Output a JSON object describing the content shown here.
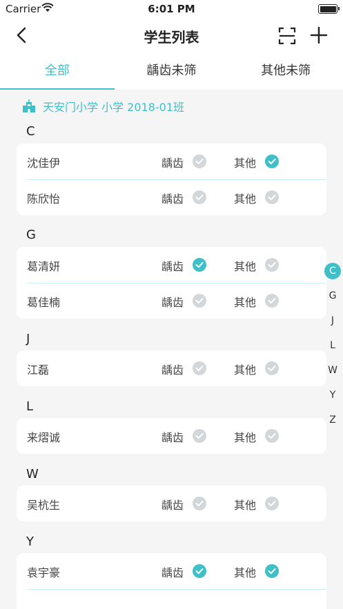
{
  "status_bar": {
    "carrier": "Carrier",
    "time": "6:01 PM"
  },
  "nav": {
    "title": "学生列表"
  },
  "tabs": [
    {
      "label": "全部",
      "active": true
    },
    {
      "label": "龋齿未筛",
      "active": false
    },
    {
      "label": "其他未筛",
      "active": false
    }
  ],
  "school": {
    "label": "天安门小学 小学 2018-01班"
  },
  "labels": {
    "caries": "龋齿",
    "other": "其他"
  },
  "colors": {
    "accent": "#3fc0c9",
    "unchecked": "#d3d7da"
  },
  "sections": [
    {
      "letter": "C",
      "students": [
        {
          "name": "沈佳伊",
          "caries_checked": false,
          "other_checked": true
        },
        {
          "name": "陈欣怡",
          "caries_checked": false,
          "other_checked": false
        }
      ]
    },
    {
      "letter": "G",
      "students": [
        {
          "name": "葛清妍",
          "caries_checked": true,
          "other_checked": false
        },
        {
          "name": "葛佳楠",
          "caries_checked": false,
          "other_checked": false
        }
      ]
    },
    {
      "letter": "J",
      "students": [
        {
          "name": "江磊",
          "caries_checked": false,
          "other_checked": false
        }
      ]
    },
    {
      "letter": "L",
      "students": [
        {
          "name": "来熠诚",
          "caries_checked": false,
          "other_checked": false
        }
      ]
    },
    {
      "letter": "W",
      "students": [
        {
          "name": "吴杭生",
          "caries_checked": false,
          "other_checked": false
        }
      ]
    },
    {
      "letter": "Y",
      "students": [
        {
          "name": "袁宇豪",
          "caries_checked": true,
          "other_checked": true
        },
        {
          "name": "",
          "caries_checked": false,
          "other_checked": false
        }
      ]
    }
  ],
  "index_bar": {
    "letters": [
      "C",
      "G",
      "J",
      "L",
      "W",
      "Y",
      "Z"
    ],
    "active": "C"
  }
}
